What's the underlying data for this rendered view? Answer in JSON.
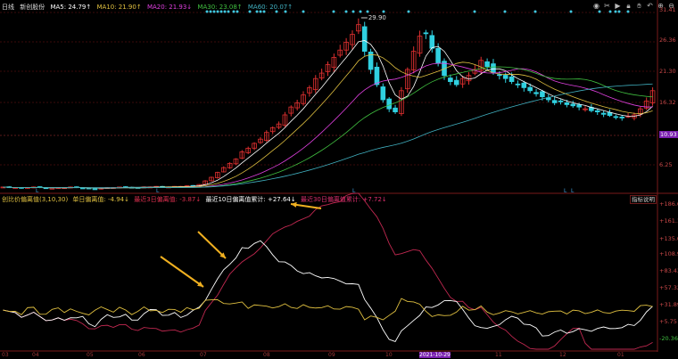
{
  "header": {
    "period": "日线",
    "name": "新创股份",
    "ma5": "MA5: 24.79↑",
    "ma10": "MA10: 21.90↑",
    "ma20": "MA20: 21.93↓",
    "ma30": "MA30: 23.08↑",
    "ma60": "MA60: 20.07↑"
  },
  "indicator": {
    "name": "创比价偏离值(3,10,30)",
    "single": "单日偏离值: -4.94↓",
    "r3": "最近3日偏离值: -3.87↓",
    "r10": "最近10日偏离值累计: +27.64↓",
    "r30": "最近30日偏离值累计: +7.72↓",
    "help": "指标说明"
  },
  "price_axis": [
    "31.41",
    "26.36",
    "21.30",
    "16.32",
    "10.93",
    "6.25"
  ],
  "ind_axis": [
    "+186.6",
    "+161.1",
    "+135.0",
    "+108.9",
    "+83.43",
    "+57.32",
    "+31.89",
    "+5.75",
    "-20.36"
  ],
  "x_axis": [
    "03",
    "04",
    "05",
    "06",
    "07",
    "08",
    "09",
    "10",
    "2021-10-29",
    "11",
    "12",
    "01"
  ],
  "peak_label": "29.90",
  "tools": [
    "eye-icon",
    "scissors-icon",
    "play-icon",
    "lock-icon",
    "hand-icon",
    "undo-icon",
    "plus-icon",
    "minus-icon"
  ],
  "colors": {
    "up": "#e03030",
    "down": "#30d0e0",
    "ma5": "#ffffff",
    "ma10": "#e0c040",
    "ma20": "#e040e0",
    "ma30": "#40c040",
    "ma60": "#40b0c0",
    "r30": "#c02850",
    "r10": "#ffffff",
    "single": "#e0c040"
  },
  "closes": [
    2.6,
    2.5,
    2.5,
    2.4,
    2.5,
    2.6,
    2.5,
    2.4,
    2.4,
    2.5,
    2.5,
    2.6,
    2.5,
    2.4,
    2.3,
    2.3,
    2.4,
    2.5,
    2.5,
    2.6,
    2.6,
    2.5,
    2.5,
    2.6,
    2.6,
    2.7,
    2.6,
    2.6,
    2.7,
    2.7,
    2.8,
    2.8,
    3.0,
    3.6,
    4.2,
    5.0,
    5.8,
    6.5,
    7.2,
    8.4,
    9.0,
    9.8,
    10.5,
    11.6,
    12.4,
    13.0,
    14.5,
    15.8,
    16.5,
    17.8,
    19.0,
    20.5,
    21.4,
    22.8,
    24.0,
    25.2,
    26.5,
    27.8,
    29.4,
    25.0,
    22.0,
    19.5,
    17.0,
    15.5,
    15.0,
    18.5,
    22.0,
    25.0,
    27.5,
    28.0,
    25.5,
    23.0,
    21.0,
    20.0,
    19.5,
    20.5,
    21.0,
    22.0,
    23.5,
    22.5,
    21.5,
    21.0,
    20.5,
    20.0,
    19.5,
    19.0,
    18.5,
    18.0,
    17.5,
    17.0,
    16.5,
    16.8,
    16.2,
    16.0,
    15.8,
    15.5,
    15.2,
    15.0,
    14.6,
    14.4,
    14.2,
    14.0,
    14.3,
    14.5,
    15.5,
    16.8,
    18.5
  ]
}
